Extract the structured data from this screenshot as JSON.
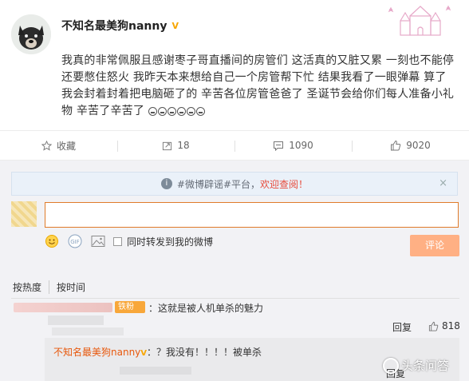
{
  "post": {
    "username": "不知名最美狗nanny",
    "badge": "V",
    "text": "我真的非常佩服且感谢枣子哥直播间的房管们 这活真的又脏又累 一刻也不能停 还要憋住怒火 我昨天本来想给自己一个房管帮下忙 结果我看了一眼弹幕 算了 我会封着封着把电脑砸了的 辛苦各位房管爸爸了 圣诞节会给你们每人准备小礼物 辛苦了辛苦了"
  },
  "actions": {
    "favorite_label": "收藏",
    "repost_count": "18",
    "comment_count": "1090",
    "like_count": "9020"
  },
  "notice": {
    "prefix": "#微博辟谣#平台，",
    "highlight": "欢迎查阅！",
    "close": "×"
  },
  "compose": {
    "checkbox_label": "同时转发到我的微博",
    "submit_label": "评论",
    "gif_label": "GIF"
  },
  "sort": {
    "hot": "按热度",
    "time": "按时间"
  },
  "comments": [
    {
      "badge": "铁粉",
      "text": "：这就是被人机单杀的魅力",
      "reply_label": "回复",
      "likes": "818",
      "replies": [
        {
          "name": "不知名最美狗nanny",
          "badge": "V",
          "text": "：？我没有！！！！被单杀",
          "reply_label": "回复"
        }
      ]
    }
  ],
  "watermark": "头条问答",
  "colors": {
    "accent": "#e8580c",
    "comment_button": "#ffb084",
    "notice_bg": "#eaf1f9",
    "gold_badge": "#f7a600"
  }
}
